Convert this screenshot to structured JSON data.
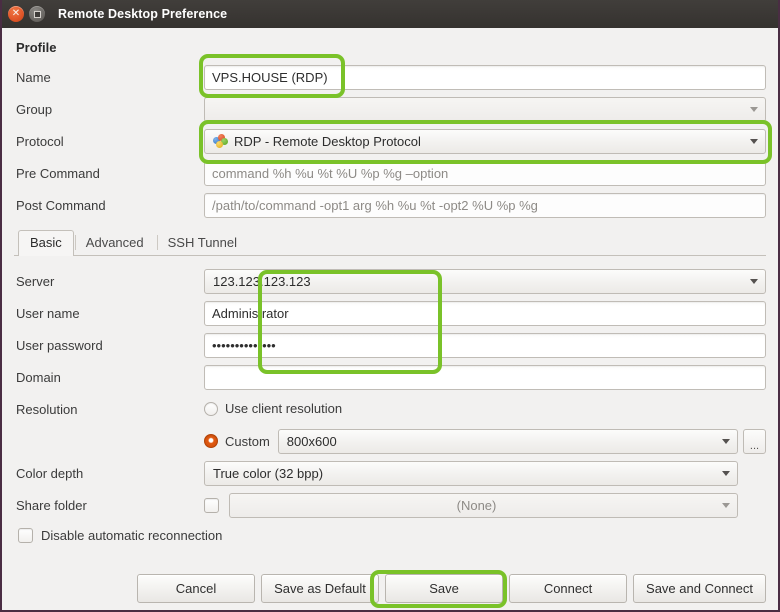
{
  "window": {
    "title": "Remote Desktop Preference",
    "close_icon": "close-icon",
    "maximize_icon": "maximize-icon"
  },
  "profile": {
    "section_label": "Profile",
    "name_label": "Name",
    "name_value": "VPS.HOUSE (RDP)",
    "group_label": "Group",
    "group_value": "",
    "protocol_label": "Protocol",
    "protocol_value": "RDP - Remote Desktop Protocol",
    "protocol_icon": "remmina-protocol-icon",
    "pre_command_label": "Pre Command",
    "pre_command_value": "",
    "pre_command_placeholder": "command %h %u %t %U %p %g –option",
    "post_command_label": "Post Command",
    "post_command_value": "",
    "post_command_placeholder": "/path/to/command -opt1 arg %h %u %t -opt2 %U %p %g"
  },
  "tabs": [
    {
      "label": "Basic",
      "active": true
    },
    {
      "label": "Advanced",
      "active": false
    },
    {
      "label": "SSH Tunnel",
      "active": false
    }
  ],
  "basic": {
    "server_label": "Server",
    "server_value": "123.123.123.123",
    "username_label": "User name",
    "username_value": "Administrator",
    "password_label": "User password",
    "password_value": "••••••••••••••",
    "domain_label": "Domain",
    "domain_value": "",
    "resolution_label": "Resolution",
    "resolution_client_label": "Use client resolution",
    "resolution_client_selected": false,
    "resolution_custom_label": "Custom",
    "resolution_custom_selected": true,
    "resolution_custom_value": "800x600",
    "resolution_browse_label": "...",
    "color_depth_label": "Color depth",
    "color_depth_value": "True color (32 bpp)",
    "share_folder_label": "Share folder",
    "share_folder_value": "(None)",
    "share_folder_checked": false,
    "disable_reconnect_label": "Disable automatic reconnection",
    "disable_reconnect_checked": false
  },
  "actions": {
    "cancel": "Cancel",
    "save_as_default": "Save as Default",
    "save": "Save",
    "connect": "Connect",
    "save_and_connect": "Save and Connect"
  },
  "highlights": {
    "color": "#7ac229",
    "targets": [
      "name-field",
      "protocol-field",
      "credentials-group",
      "save-button"
    ]
  }
}
